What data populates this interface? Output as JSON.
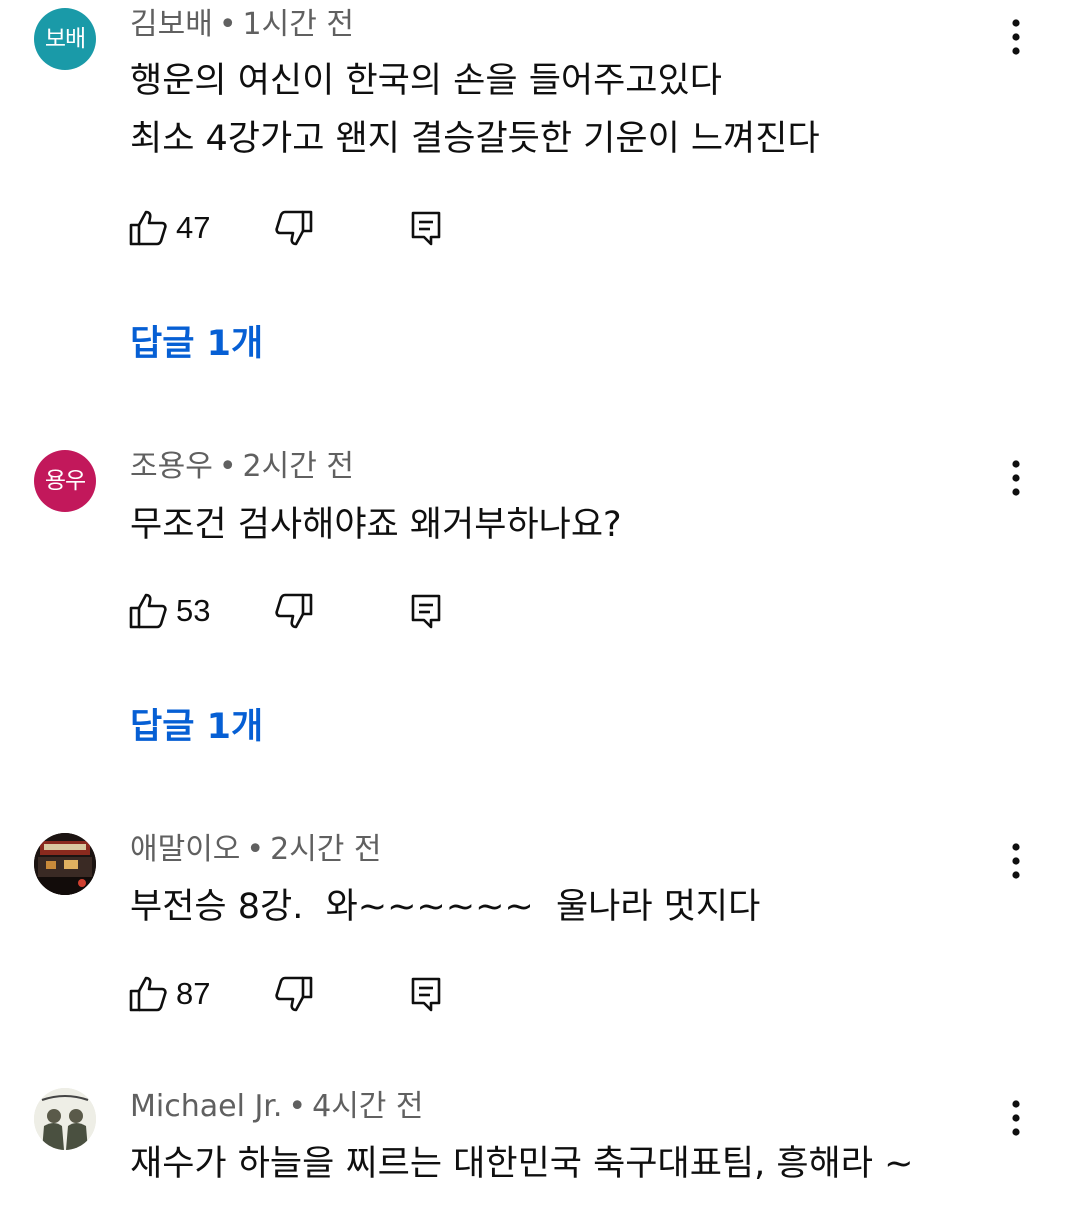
{
  "comments": [
    {
      "avatar_text": "보배",
      "avatar_color": "#1a9aa8",
      "author": "김보배",
      "separator": "•",
      "time": "1시간 전",
      "lines": [
        "행운의 여신이 한국의 손을 들어주고있다",
        "최소 4강가고 왠지 결승갈듯한 기운이 느껴진다"
      ],
      "likes": "47",
      "replies_label": "답글 1개"
    },
    {
      "avatar_text": "용우",
      "avatar_color": "#c2185b",
      "author": "조용우",
      "separator": "•",
      "time": "2시간 전",
      "lines": [
        "무조건 검사해야죠 왜거부하나요?"
      ],
      "likes": "53",
      "replies_label": "답글 1개"
    },
    {
      "avatar_text": "",
      "avatar_color": "#2a1e1a",
      "author": "애말이오",
      "separator": "•",
      "time": "2시간 전",
      "lines": [
        "부전승 8강.  와~~~~~~  울나라 멋지다"
      ],
      "likes": "87",
      "replies_label": ""
    },
    {
      "avatar_text": "",
      "avatar_color": "#e8e8e0",
      "author": "Michael Jr.",
      "separator": "•",
      "time": "4시간 전",
      "lines": [
        "재수가 하늘을 찌르는 대한민국 축구대표팀, 흥해라 ~"
      ],
      "likes": "",
      "replies_label": ""
    }
  ],
  "icons": {
    "like": "thumb-up-icon",
    "dislike": "thumb-down-icon",
    "reply": "reply-comment-icon",
    "more": "more-vertical-icon"
  }
}
